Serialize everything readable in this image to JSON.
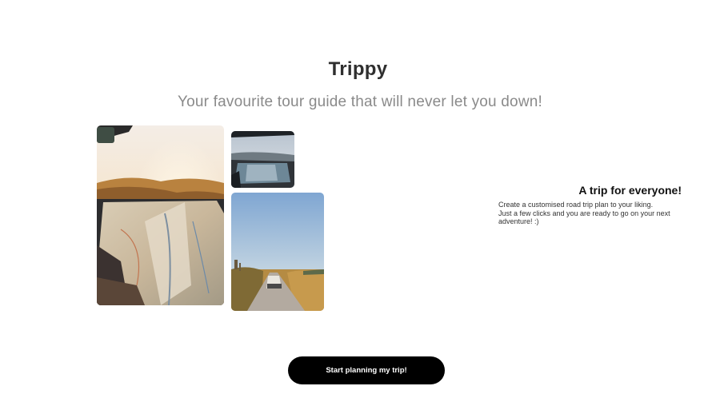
{
  "header": {
    "title": "Trippy",
    "subtitle": "Your favourite tour guide that will never let you down!"
  },
  "feature": {
    "heading": "A trip for everyone!",
    "line1": "Create a customised road trip plan to your liking.",
    "line2": "Just a few clicks and you are ready to go on your next",
    "line3": "adventure! :)"
  },
  "cta": {
    "label": "Start planning my trip!"
  },
  "images": [
    "map-in-car-photo",
    "car-dashboard-photo",
    "campervan-road-photo"
  ]
}
